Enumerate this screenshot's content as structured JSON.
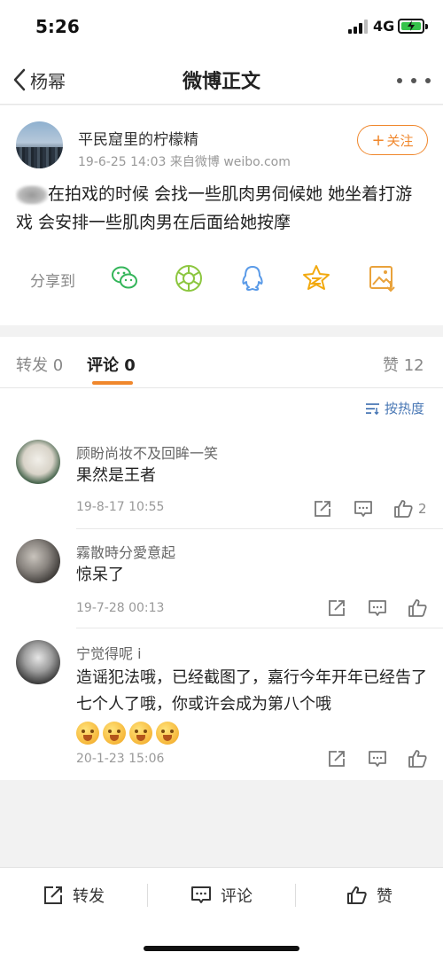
{
  "status_bar": {
    "time": "5:26",
    "network": "4G"
  },
  "nav": {
    "back_label": "杨幂",
    "title": "微博正文"
  },
  "post": {
    "username": "平民窟里的柠檬精",
    "meta": "19-6-25 14:03  来自微博 weibo.com",
    "follow_label": "关注",
    "text": "在拍戏的时候 会找一些肌肉男伺候她 她坐着打游戏 会安排一些肌肉男在后面给她按摩",
    "share_label": "分享到",
    "share_icons": [
      "wechat-icon",
      "moments-icon",
      "qq-icon",
      "qzone-icon",
      "save-image-icon"
    ]
  },
  "tabs": {
    "repost": "转发 0",
    "comment": "评论 0",
    "like": "赞 12"
  },
  "sort_label": "按热度",
  "comments": [
    {
      "name": "顾盼尚妆不及回眸一笑",
      "text": "果然是王者",
      "time": "19-8-17 10:55",
      "likes": "2"
    },
    {
      "name": "霧散時分愛意起",
      "text": "惊呆了",
      "time": "19-7-28 00:13",
      "likes": ""
    },
    {
      "name": "宁觉得呢 i",
      "text": "造谣犯法哦，已经截图了，嘉行今年开年已经告了七个人了哦，你或许会成为第八个哦",
      "time": "20-1-23 15:06",
      "likes": ""
    }
  ],
  "bottom_bar": {
    "repost": "转发",
    "comment": "评论",
    "like": "赞"
  },
  "colors": {
    "accent": "#f0872c",
    "link": "#4a78b5",
    "wechat": "#34b55a",
    "qq": "#5b9be8",
    "star": "#f2a90f"
  }
}
